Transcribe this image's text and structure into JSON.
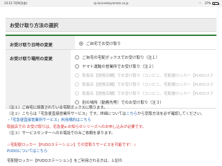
{
  "status_bar": {
    "time": "13:13",
    "date": "7月9日(金)",
    "url": "sp.kuronekoyamato.co.jp",
    "wifi": "◠",
    "battery_pct": "37%",
    "battery_level": 0.37
  },
  "section_title": "お受け取り方法の選択",
  "rows": [
    {
      "label": "お受け取り日時の変更",
      "options": [
        {
          "text": "ご自宅でお受け取り",
          "checked": true,
          "disabled": false
        }
      ]
    },
    {
      "label": "お受け取り場所の変更",
      "options": [
        {
          "text": "ご自宅の宅配ボックスでお受け取り（注１）",
          "checked": false,
          "disabled": false
        },
        {
          "text": "ヤマト運輸の営業所でお受け取り（注２）",
          "checked": false,
          "disabled": false
        },
        {
          "text": "取扱店【提携店舗】でお受け取り（コンビニ、宅配便ロッカー【PUDOステ",
          "checked": false,
          "disabled": true
        },
        {
          "text": "取扱店【提携店舗】でお受け取り（コンビニ、宅配便ロッカー【PUDOステ",
          "checked": false,
          "disabled": true
        },
        {
          "text": "取扱店【提携店舗】でお受け取り（コンビニ、宅配便ロッカー【PUDOステ",
          "checked": false,
          "disabled": true
        },
        {
          "text": "別の場所（勤務先等）でのお受け取り（注３）",
          "checked": false,
          "disabled": false
        }
      ]
    }
  ],
  "notes": {
    "n1": "（注１）ご自宅に設置されている宅配ボックスに限ります。",
    "n2_pre": "（注２）こちらは「宅急便直接営業所サービス」です。詳細については",
    "n2_link": "こちら",
    "n2_post": "から受取方法を必ず確認してください。",
    "n3_link": "・「宅急便直接営業所サービス」利用規約はこちら",
    "n4_red": "取扱店での お受け取りは、宅急便e-お知らせシリーズへのお申し込みが必要です。",
    "n5": "（注３）サービスセンターへのお電話でのみご依頼を承ります。"
  },
  "pudo": {
    "line1": "☆宅配便ロッカー【PUDOステーション】での受取りサービスを可能です！☆",
    "line2": "PUDOについてはこちら"
  },
  "bottom_text": "宅配便ロッカー【PUDOステーション】をご利用される方は、上記の",
  "colors": {
    "accent_green": "#2e7d32",
    "link_blue": "#1a5fb4",
    "warning_red": "#d32f2f"
  }
}
